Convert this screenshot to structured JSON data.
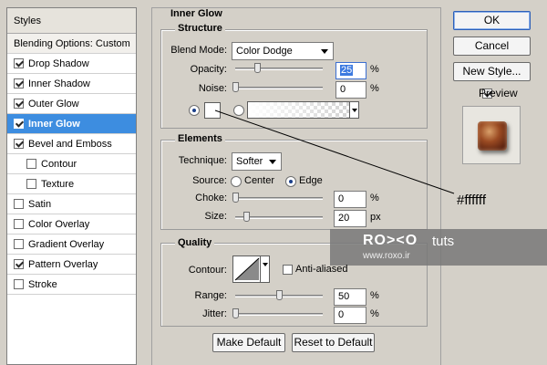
{
  "styles_panel": {
    "title": "Styles",
    "blending_options": "Blending Options: Custom",
    "items": [
      {
        "label": "Drop Shadow",
        "checked": true
      },
      {
        "label": "Inner Shadow",
        "checked": true
      },
      {
        "label": "Outer Glow",
        "checked": true
      },
      {
        "label": "Inner Glow",
        "checked": true,
        "selected": true
      },
      {
        "label": "Bevel and Emboss",
        "checked": true
      },
      {
        "label": "Contour",
        "checked": false,
        "sub": true
      },
      {
        "label": "Texture",
        "checked": false,
        "sub": true
      },
      {
        "label": "Satin",
        "checked": false
      },
      {
        "label": "Color Overlay",
        "checked": false
      },
      {
        "label": "Gradient Overlay",
        "checked": false
      },
      {
        "label": "Pattern Overlay",
        "checked": true
      },
      {
        "label": "Stroke",
        "checked": false
      }
    ]
  },
  "inner_glow": {
    "title": "Inner Glow",
    "structure": {
      "title": "Structure",
      "blend_mode_label": "Blend Mode:",
      "blend_mode_value": "Color Dodge",
      "opacity_label": "Opacity:",
      "opacity_value": "25",
      "opacity_unit": "%",
      "noise_label": "Noise:",
      "noise_value": "0",
      "noise_unit": "%",
      "color_selected": true,
      "color_hex": "#ffffff"
    },
    "elements": {
      "title": "Elements",
      "technique_label": "Technique:",
      "technique_value": "Softer",
      "source_label": "Source:",
      "source_center": "Center",
      "source_edge": "Edge",
      "choke_label": "Choke:",
      "choke_value": "0",
      "choke_unit": "%",
      "size_label": "Size:",
      "size_value": "20",
      "size_unit": "px"
    },
    "quality": {
      "title": "Quality",
      "contour_label": "Contour:",
      "anti_aliased_label": "Anti-aliased",
      "range_label": "Range:",
      "range_value": "50",
      "range_unit": "%",
      "jitter_label": "Jitter:",
      "jitter_value": "0",
      "jitter_unit": "%"
    },
    "make_default": "Make Default",
    "reset_default": "Reset to Default"
  },
  "buttons": {
    "ok": "OK",
    "cancel": "Cancel",
    "new_style": "New Style...",
    "preview": "Preview"
  },
  "annotation": {
    "color_text": "#ffffff"
  },
  "watermark": {
    "brand": "RO><O",
    "brand_suffix": "tuts",
    "url": "www.roxo.ir"
  },
  "colors": {
    "dialog_bg": "#d4d0c8",
    "selection": "#3d8de0",
    "watermark_band": "#7f7f7f"
  }
}
